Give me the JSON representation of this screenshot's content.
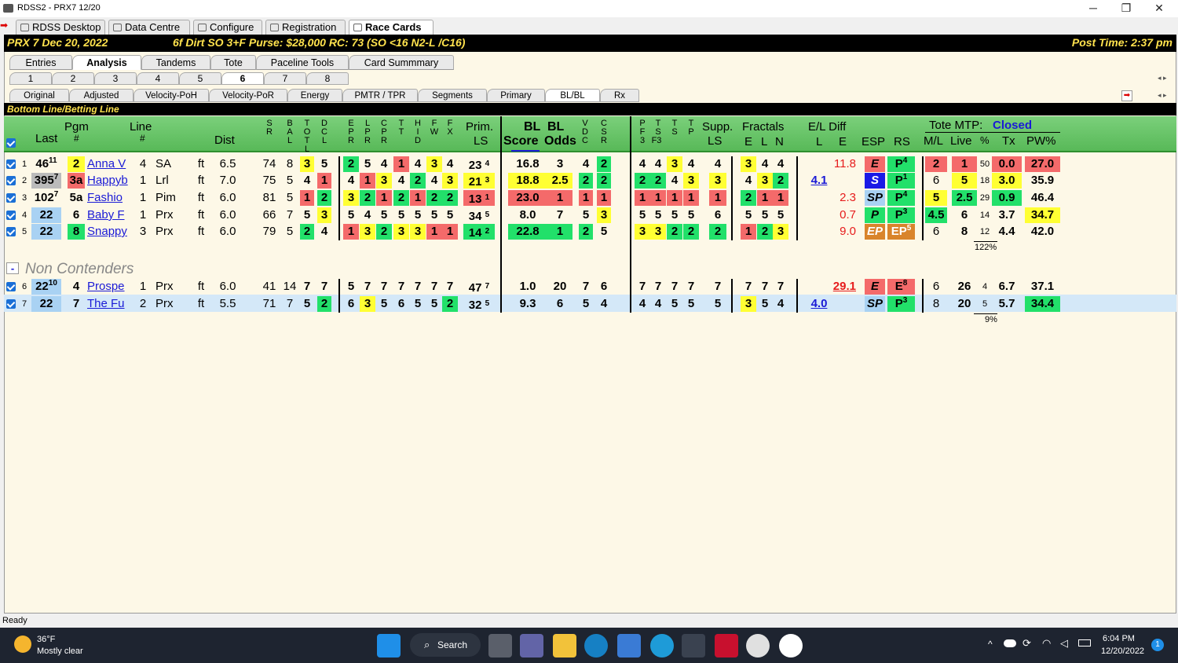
{
  "window": {
    "title": "RDSS2 - PRX7  12/20",
    "min": "─",
    "max": "❐",
    "close": "✕"
  },
  "toptabs": [
    "RDSS Desktop",
    "Data Centre",
    "Configure",
    "Registration",
    "Race Cards"
  ],
  "race": {
    "info1": "PRX 7  Dec 20, 2022",
    "info2": "6f Dirt  SO 3+F  Purse: $28,000  RC: 73  (SO <16 N2-L /C16)",
    "post": "Post Time: 2:37 pm"
  },
  "maintabs": [
    "Entries",
    "Analysis",
    "Tandems",
    "Tote",
    "Paceline Tools",
    "Card Summmary"
  ],
  "numtabs": [
    "1",
    "2",
    "3",
    "4",
    "5",
    "6",
    "7",
    "8"
  ],
  "subtabs": [
    "Original",
    "Adjusted",
    "Velocity-PoH",
    "Velocity-PoR",
    "Energy",
    "PMTR / TPR",
    "Segments",
    "Primary",
    "BL/BL",
    "Rx"
  ],
  "section_title": "Bottom Line/Betting Line",
  "headers": {
    "pgm": "Pgm",
    "pgm2": "#",
    "last": "Last",
    "line": "Line",
    "line2": "#",
    "dist": "Dist",
    "sr": "SR",
    "bal": "BAL",
    "totl": "TOTL",
    "dcl": "DCL",
    "epr": "EPR",
    "lpr": "LPR",
    "cpr": "CPR",
    "tt": "TT",
    "hid": "HID",
    "fw": "FW",
    "fx": "FX",
    "prim": "Prim.",
    "ls": "LS",
    "bl1": "BL",
    "bl2": "BL",
    "score": "Score",
    "odds": "Odds",
    "vdc": "VDC",
    "csr": "CSR",
    "pf3": "PF3",
    "tsf3": "TSF3",
    "ts": "TS",
    "tp": "TP",
    "supp": "Supp.",
    "supp2": "LS",
    "fract": "Fractals",
    "e": "E",
    "l": "L",
    "n": "N",
    "eld": "E/L Diff",
    "eldl": "L",
    "elde": "E",
    "esp": "ESP",
    "rs": "RS",
    "tote": "Tote MTP:",
    "closed": "Closed",
    "ml": "M/L",
    "live": "Live",
    "pct": "%",
    "tx": "Tx",
    "pw": "PW%"
  },
  "rows": [
    {
      "n": "1",
      "last": "46",
      "lastsup": "11",
      "pgm": "2",
      "name": "Anna V",
      "line": "4",
      "trk": "SA",
      "sf": "ft",
      "dist": "6.5",
      "sr": "74",
      "bal": "8",
      "totl": "3",
      "dcl": "5",
      "f": [
        "2",
        "5",
        "4",
        "1",
        "4",
        "3",
        "4"
      ],
      "prim": "23",
      "primsub": "4",
      "score": "16.8",
      "odds": "3",
      "vdc": "4",
      "csr": "2",
      "pf": [
        "4",
        "4",
        "3",
        "4"
      ],
      "supp": "4",
      "fr": [
        "3",
        "4",
        "4"
      ],
      "l": "",
      "e": "11.8",
      "esp": "E",
      "rs": "P",
      "rssup": "4",
      "ml": "2",
      "live": "1",
      "pct": "50",
      "tx": "0.0",
      "pw": "27.0"
    },
    {
      "n": "2",
      "last": "395",
      "lastsup": "7",
      "pgm": "3a",
      "name": "Happyb",
      "line": "1",
      "trk": "Lrl",
      "sf": "ft",
      "dist": "7.0",
      "sr": "75",
      "bal": "5",
      "totl": "4",
      "dcl": "1",
      "f": [
        "4",
        "1",
        "3",
        "4",
        "2",
        "4",
        "3"
      ],
      "prim": "21",
      "primsub": "3",
      "score": "18.8",
      "odds": "2.5",
      "vdc": "2",
      "csr": "2",
      "pf": [
        "2",
        "2",
        "4",
        "3"
      ],
      "supp": "3",
      "fr": [
        "4",
        "3",
        "2"
      ],
      "l": "4.1",
      "e": "",
      "esp": "S",
      "rs": "P",
      "rssup": "1",
      "ml": "6",
      "live": "5",
      "pct": "18",
      "tx": "3.0",
      "pw": "35.9"
    },
    {
      "n": "3",
      "last": "102",
      "lastsup": "7",
      "pgm": "5a",
      "name": "Fashio",
      "line": "1",
      "trk": "Pim",
      "sf": "ft",
      "dist": "6.0",
      "sr": "81",
      "bal": "5",
      "totl": "1",
      "dcl": "2",
      "f": [
        "3",
        "2",
        "1",
        "2",
        "1",
        "2",
        "2"
      ],
      "prim": "13",
      "primsub": "1",
      "score": "23.0",
      "odds": "1",
      "vdc": "1",
      "csr": "1",
      "pf": [
        "1",
        "1",
        "1",
        "1"
      ],
      "supp": "1",
      "fr": [
        "2",
        "1",
        "1"
      ],
      "l": "",
      "e": "2.3",
      "esp": "SP",
      "rs": "P",
      "rssup": "4",
      "ml": "5",
      "live": "2.5",
      "pct": "29",
      "tx": "0.9",
      "pw": "46.4"
    },
    {
      "n": "4",
      "last": "22",
      "lastsup": "",
      "pgm": "6",
      "name": "Baby F",
      "line": "1",
      "trk": "Prx",
      "sf": "ft",
      "dist": "6.0",
      "sr": "66",
      "bal": "7",
      "totl": "5",
      "dcl": "3",
      "f": [
        "5",
        "4",
        "5",
        "5",
        "5",
        "5",
        "5"
      ],
      "prim": "34",
      "primsub": "5",
      "score": "8.0",
      "odds": "7",
      "vdc": "5",
      "csr": "3",
      "pf": [
        "5",
        "5",
        "5",
        "5"
      ],
      "supp": "6",
      "fr": [
        "5",
        "5",
        "5"
      ],
      "l": "",
      "e": "0.7",
      "esp": "P",
      "rs": "P",
      "rssup": "3",
      "ml": "4.5",
      "live": "6",
      "pct": "14",
      "tx": "3.7",
      "pw": "34.7"
    },
    {
      "n": "5",
      "last": "22",
      "lastsup": "",
      "pgm": "8",
      "name": "Snappy",
      "line": "3",
      "trk": "Prx",
      "sf": "ft",
      "dist": "6.0",
      "sr": "79",
      "bal": "5",
      "totl": "2",
      "dcl": "4",
      "f": [
        "1",
        "3",
        "2",
        "3",
        "3",
        "1",
        "1"
      ],
      "prim": "14",
      "primsub": "2",
      "score": "22.8",
      "odds": "1",
      "vdc": "2",
      "csr": "5",
      "pf": [
        "3",
        "3",
        "2",
        "2"
      ],
      "supp": "2",
      "fr": [
        "1",
        "2",
        "3"
      ],
      "l": "",
      "e": "9.0",
      "esp": "EP",
      "rs": "EP",
      "rssup": "5",
      "ml": "6",
      "live": "8",
      "pct": "12",
      "tx": "4.4",
      "pw": "42.0"
    },
    {
      "n": "6",
      "last": "22",
      "lastsup": "10",
      "pgm": "4",
      "name": "Prospe",
      "line": "1",
      "trk": "Prx",
      "sf": "ft",
      "dist": "6.0",
      "sr": "41",
      "bal": "14",
      "totl": "7",
      "dcl": "7",
      "f": [
        "5",
        "7",
        "7",
        "7",
        "7",
        "7",
        "7"
      ],
      "prim": "47",
      "primsub": "7",
      "score": "1.0",
      "odds": "20",
      "vdc": "7",
      "csr": "6",
      "pf": [
        "7",
        "7",
        "7",
        "7"
      ],
      "supp": "7",
      "fr": [
        "7",
        "7",
        "7"
      ],
      "l": "",
      "e": "29.1",
      "esp": "E",
      "rs": "E",
      "rssup": "8",
      "ml": "6",
      "live": "26",
      "pct": "4",
      "tx": "6.7",
      "pw": "37.1"
    },
    {
      "n": "7",
      "last": "22",
      "lastsup": "",
      "pgm": "7",
      "name": "The Fu",
      "line": "2",
      "trk": "Prx",
      "sf": "ft",
      "dist": "5.5",
      "sr": "71",
      "bal": "7",
      "totl": "5",
      "dcl": "2",
      "f": [
        "6",
        "3",
        "5",
        "6",
        "5",
        "5",
        "2"
      ],
      "prim": "32",
      "primsub": "5",
      "score": "9.3",
      "odds": "6",
      "vdc": "5",
      "csr": "4",
      "pf": [
        "4",
        "4",
        "5",
        "5"
      ],
      "supp": "5",
      "fr": [
        "3",
        "5",
        "4"
      ],
      "l": "4.0",
      "e": "",
      "esp": "SP",
      "rs": "P",
      "rssup": "3",
      "ml": "8",
      "live": "20",
      "pct": "5",
      "tx": "5.7",
      "pw": "34.4"
    }
  ],
  "tot1": "122%",
  "tot2": "9%",
  "noncont": "Non Contenders",
  "minus": "-",
  "status": "Ready",
  "weather": {
    "temp": "36°F",
    "desc": "Mostly clear"
  },
  "search": "Search",
  "clock": {
    "time": "6:04 PM",
    "date": "12/20/2022"
  },
  "notif": "1"
}
